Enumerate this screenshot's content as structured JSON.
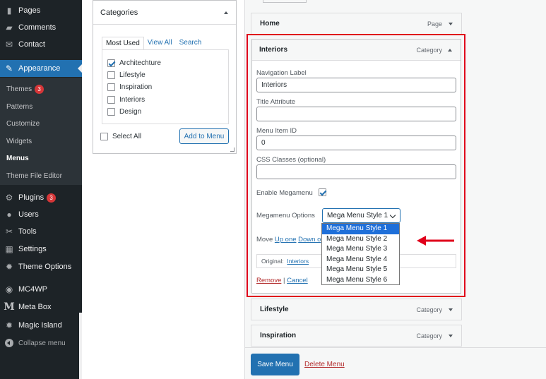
{
  "sidebar": {
    "top_items": [
      {
        "label": "Pages",
        "icon": "pages-icon"
      },
      {
        "label": "Comments",
        "icon": "comments-icon"
      },
      {
        "label": "Contact",
        "icon": "contact-icon"
      }
    ],
    "appearance": {
      "label": "Appearance",
      "icon": "brush-icon"
    },
    "submenu": [
      {
        "label": "Themes",
        "badge": "3"
      },
      {
        "label": "Patterns"
      },
      {
        "label": "Customize"
      },
      {
        "label": "Widgets"
      },
      {
        "label": "Menus"
      },
      {
        "label": "Theme File Editor"
      }
    ],
    "bottom_items": [
      {
        "label": "Plugins",
        "badge": "3",
        "icon": "plugins-icon"
      },
      {
        "label": "Users",
        "icon": "users-icon"
      },
      {
        "label": "Tools",
        "icon": "tools-icon"
      },
      {
        "label": "Settings",
        "icon": "settings-icon"
      },
      {
        "label": "Theme Options",
        "icon": "gear-icon"
      },
      {
        "label": "MC4WP",
        "icon": "mc4wp-icon"
      },
      {
        "label": "Meta Box",
        "icon": "meta-box-icon",
        "glyph": "M"
      },
      {
        "label": "Magic Island",
        "icon": "gear-icon"
      }
    ],
    "collapse_label": "Collapse menu"
  },
  "categories_box": {
    "title": "Categories",
    "tabs": [
      "Most Used",
      "View All",
      "Search"
    ],
    "items": [
      {
        "label": "Architechture",
        "checked": true
      },
      {
        "label": "Lifestyle",
        "checked": false
      },
      {
        "label": "Inspiration",
        "checked": false
      },
      {
        "label": "Interiors",
        "checked": false
      },
      {
        "label": "Design",
        "checked": false
      }
    ],
    "select_all": "Select All",
    "add_button": "Add to Menu"
  },
  "menu": {
    "home": {
      "title": "Home",
      "type": "Page"
    },
    "interiors": {
      "title": "Interiors",
      "type": "Category",
      "nav_label_label": "Navigation Label",
      "nav_label_value": "Interiors",
      "title_attr_label": "Title Attribute",
      "title_attr_value": "",
      "item_id_label": "Menu Item ID",
      "item_id_value": "0",
      "css_label": "CSS Classes (optional)",
      "css_value": "",
      "megamenu_label": "Enable Megamenu",
      "megamenu_checked": true,
      "options_label": "Megamenu Options",
      "selected_option": "Mega Menu Style 1",
      "options": [
        "Mega Menu Style 1",
        "Mega Menu Style 2",
        "Mega Menu Style 3",
        "Mega Menu Style 4",
        "Mega Menu Style 5",
        "Mega Menu Style 6"
      ],
      "move_label": "Move",
      "up_one": "Up one",
      "down_one": "Down o",
      "original_label": "Original:",
      "original_link": "Interiors",
      "remove": "Remove",
      "separator": "|",
      "cancel": "Cancel"
    },
    "lifestyle": {
      "title": "Lifestyle",
      "type": "Category"
    },
    "inspiration": {
      "title": "Inspiration",
      "type": "Category"
    }
  },
  "footer": {
    "save": "Save Menu",
    "delete": "Delete Menu"
  },
  "colors": {
    "accent": "#2271b1",
    "highlight_frame": "#e0001b",
    "sidebar_bg": "#1d2327"
  }
}
